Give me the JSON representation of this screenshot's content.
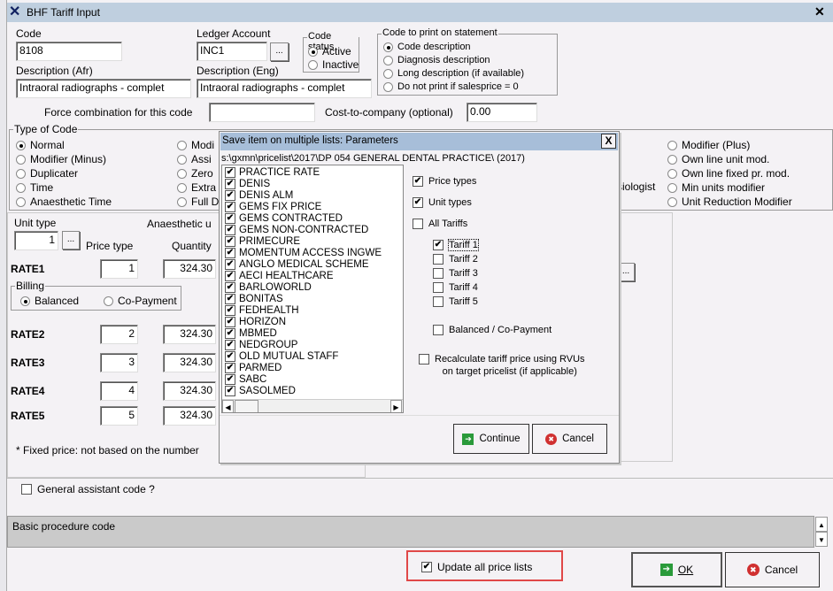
{
  "window": {
    "title": "BHF Tariff Input",
    "close": "✕"
  },
  "code": {
    "label": "Code",
    "value": "8108"
  },
  "ledger": {
    "label": "Ledger Account",
    "value": "INC1",
    "browse": "..."
  },
  "code_status": {
    "title": "Code status",
    "options": [
      "Active",
      "Inactive"
    ],
    "selected": 0
  },
  "print_code": {
    "title": "Code to print on statement",
    "options": [
      "Code description",
      "Diagnosis description",
      "Long description (if available)",
      "Do not print if salesprice = 0"
    ],
    "selected": 0
  },
  "desc_afr": {
    "label": "Description (Afr)",
    "value": "Intraoral radiographs - complet"
  },
  "desc_eng": {
    "label": "Description (Eng)",
    "value": "Intraoral radiographs - complet"
  },
  "force": {
    "label": "Force combination for this code",
    "value": ""
  },
  "cost": {
    "label": "Cost-to-company (optional)",
    "value": "0.00"
  },
  "type_of_code": {
    "title": "Type of Code",
    "col1": [
      "Normal",
      "Modifier (Minus)",
      "Duplicater",
      "Time",
      "Anaesthetic Time"
    ],
    "col2": [
      "Modi",
      "Assi",
      "Zero",
      "Extra",
      "Full D"
    ],
    "hidden_text": "siologist",
    "col4": [
      "Modifier (Plus)",
      "Own line unit mod.",
      "Own line fixed pr. mod.",
      "Min units modifier",
      "Unit Reduction Modifier"
    ]
  },
  "units": {
    "unit_type_label": "Unit type",
    "unit_type_value": "1",
    "browse": "...",
    "anaesthetic_label": "Anaesthetic u",
    "price_type_label": "Price type",
    "quantity_label": "Quantity",
    "rates": [
      {
        "name": "RATE1",
        "price_type": "1",
        "qty": "324.30"
      },
      {
        "name": "RATE2",
        "price_type": "2",
        "qty": "324.30"
      },
      {
        "name": "RATE3",
        "price_type": "3",
        "qty": "324.30"
      },
      {
        "name": "RATE4",
        "price_type": "4",
        "qty": "324.30"
      },
      {
        "name": "RATE5",
        "price_type": "5",
        "qty": "324.30"
      }
    ],
    "billing": {
      "title": "Billing",
      "options": [
        "Balanced",
        "Co-Payment"
      ],
      "selected": 0
    },
    "footnote": "* Fixed price: not based on the number"
  },
  "right_browse": "...",
  "general_assistant": {
    "label": "General assistant code ?",
    "checked": false
  },
  "notes": {
    "value": "Basic procedure code",
    "up": "▲",
    "down": "▼"
  },
  "update_all": {
    "label": "Update all price lists",
    "checked": true
  },
  "ok_label": "OK",
  "cancel_label": "Cancel",
  "dialog": {
    "title": "Save item on multiple lists: Parameters",
    "close": "X",
    "path": "s:\\gxmn\\pricelist\\2017\\DP 054 GENERAL DENTAL PRACTICE\\ (2017)",
    "lists": [
      "PRACTICE RATE",
      "DENIS",
      "DENIS ALM",
      "GEMS FIX PRICE",
      "GEMS CONTRACTED",
      "GEMS NON-CONTRACTED",
      "PRIMECURE",
      "MOMENTUM ACCESS INGWE",
      "ANGLO MEDICAL SCHEME",
      "AECI HEALTHCARE",
      "BARLOWORLD",
      "BONITAS",
      "FEDHEALTH",
      "HORIZON",
      "MBMED",
      "NEDGROUP",
      "OLD MUTUAL STAFF",
      "PARMED",
      "SABC",
      "SASOLMED"
    ],
    "price_types": "Price types",
    "unit_types": "Unit types",
    "all_tariffs": "All Tariffs",
    "tariffs": [
      {
        "label": "Tariff 1",
        "checked": true
      },
      {
        "label": "Tariff 2",
        "checked": false
      },
      {
        "label": "Tariff 3",
        "checked": false
      },
      {
        "label": "Tariff 4",
        "checked": false
      },
      {
        "label": "Tariff 5",
        "checked": false
      }
    ],
    "balanced_copay": "Balanced / Co-Payment",
    "recalc_line1": "Recalculate tariff price using RVUs",
    "recalc_line2": "on target pricelist (if applicable)",
    "continue": "Continue",
    "cancel": "Cancel",
    "scroll_left": "◀",
    "scroll_right": "▶"
  }
}
